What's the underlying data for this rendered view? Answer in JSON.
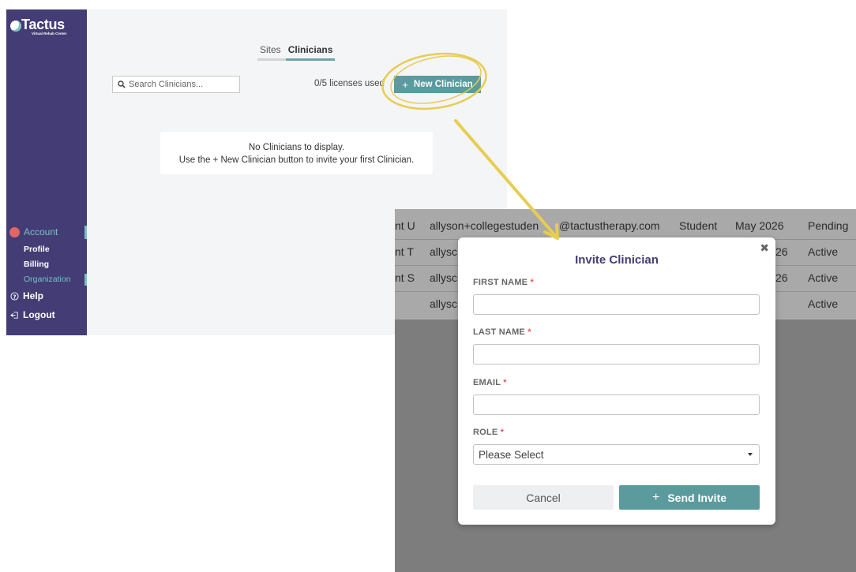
{
  "brand": {
    "name": "Tactus",
    "tagline": "Virtual Rehab Center",
    "accent": "#5b9a9d",
    "sidebar_color": "#433c75",
    "highlight_color": "#e7cd52"
  },
  "sidebar": {
    "account_label": "Account",
    "items": [
      {
        "label": "Profile"
      },
      {
        "label": "Billing"
      },
      {
        "label": "Organization",
        "active": true
      }
    ],
    "help_label": "Help",
    "logout_label": "Logout"
  },
  "tabs": [
    {
      "label": "Sites",
      "active": false
    },
    {
      "label": "Clinicians",
      "active": true
    }
  ],
  "search": {
    "placeholder": "Search Clinicians..."
  },
  "licenses_text": "0/5 licenses used",
  "new_clinician_label": "New Clinician",
  "empty_state": {
    "line1": "No Clinicians to display.",
    "line2": "Use the + New Clinician button to invite your first Clinician."
  },
  "background_table": {
    "rows": [
      {
        "name": "nt U",
        "email": "allyson+collegestuden",
        "email_tail": "@tactustherapy.com",
        "role": "Student",
        "date": "May 2026",
        "status": "Pending"
      },
      {
        "name": "nt T",
        "email": "allysc",
        "email_tail": "",
        "role": "",
        "date": "26",
        "status": "Active"
      },
      {
        "name": "nt S",
        "email": "allysc",
        "email_tail": "",
        "role": "",
        "date": "26",
        "status": "Active"
      },
      {
        "name": "",
        "email": "allysc",
        "email_tail": "",
        "role": "",
        "date": "",
        "status": "Active"
      }
    ]
  },
  "modal": {
    "title": "Invite Clinician",
    "close_symbol": "✖",
    "fields": {
      "first_name": {
        "label": "FIRST NAME",
        "value": ""
      },
      "last_name": {
        "label": "LAST NAME",
        "value": ""
      },
      "email": {
        "label": "EMAIL",
        "value": ""
      },
      "role": {
        "label": "ROLE",
        "selected": "Please Select"
      }
    },
    "required_mark": "*",
    "cancel_label": "Cancel",
    "send_label": "Send Invite"
  }
}
